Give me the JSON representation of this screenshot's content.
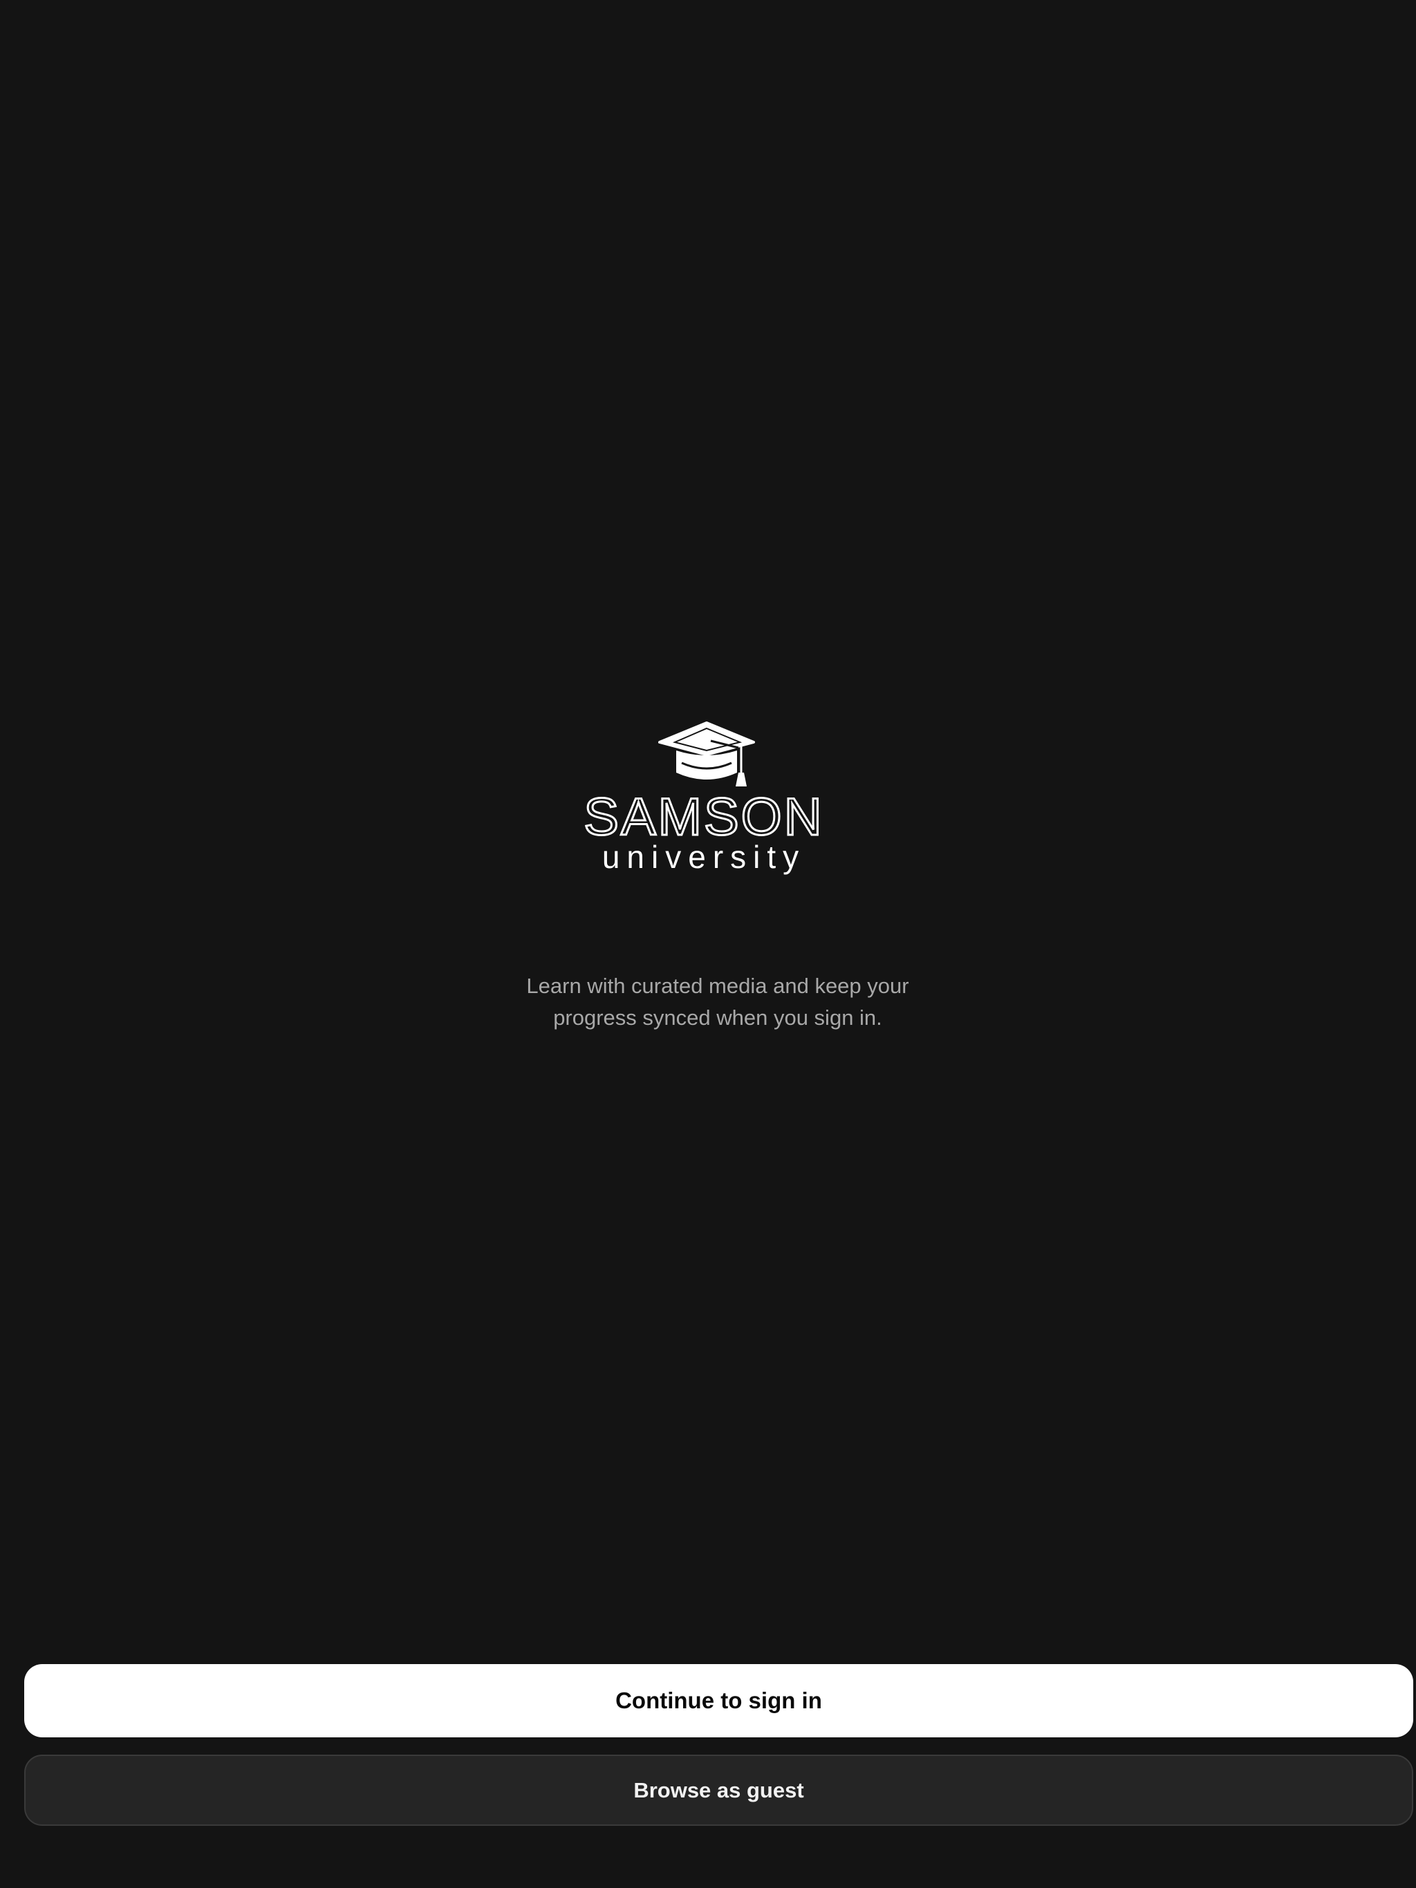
{
  "brand": {
    "name": "SAMSON",
    "subname": "university",
    "logo_icon": "graduation-cap-icon",
    "logo_color": "#ffffff"
  },
  "welcome": {
    "tagline_line1": "Learn with curated media and keep your",
    "tagline_line2": "progress synced when you sign in."
  },
  "actions": {
    "sign_in_label": "Continue to sign in",
    "guest_label": "Browse as guest"
  },
  "colors": {
    "background": "#141414",
    "primary_button": "#ffffff",
    "secondary_button": "#252525",
    "tagline_text": "#a8a8a8"
  }
}
